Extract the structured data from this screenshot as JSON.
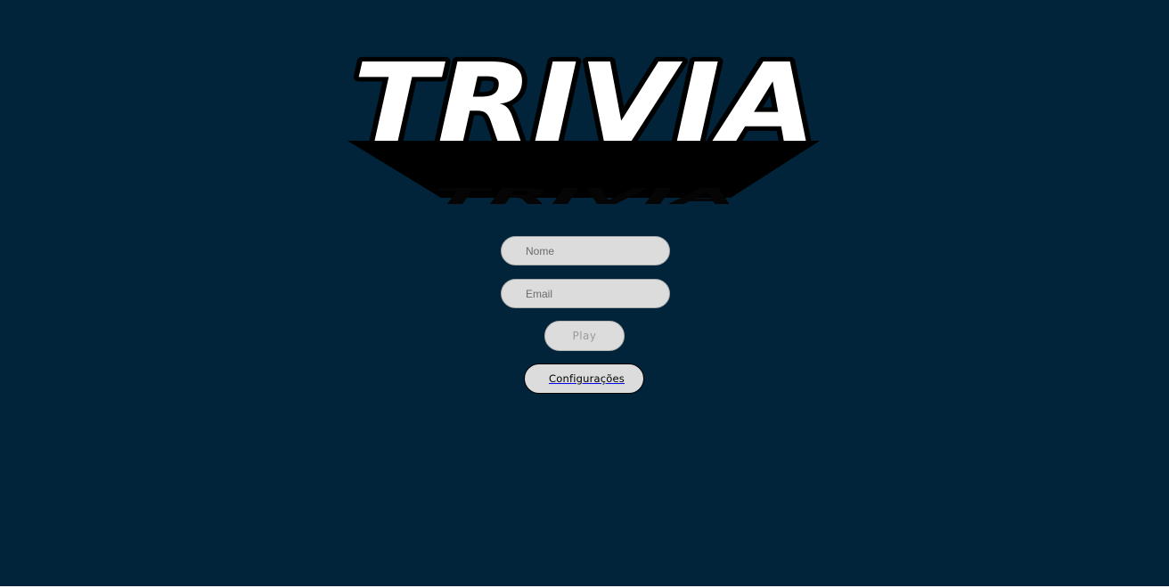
{
  "logo": {
    "text": "TRIVIA",
    "fill_color": "#ffffff",
    "outline_color": "#000000",
    "shadow_color": "#000000"
  },
  "login": {
    "name_placeholder": "Nome",
    "email_placeholder": "Email",
    "play_label": "Play",
    "settings_label": "Configurações"
  },
  "theme": {
    "background": "#01243a",
    "field_background": "#dcdcdc"
  }
}
